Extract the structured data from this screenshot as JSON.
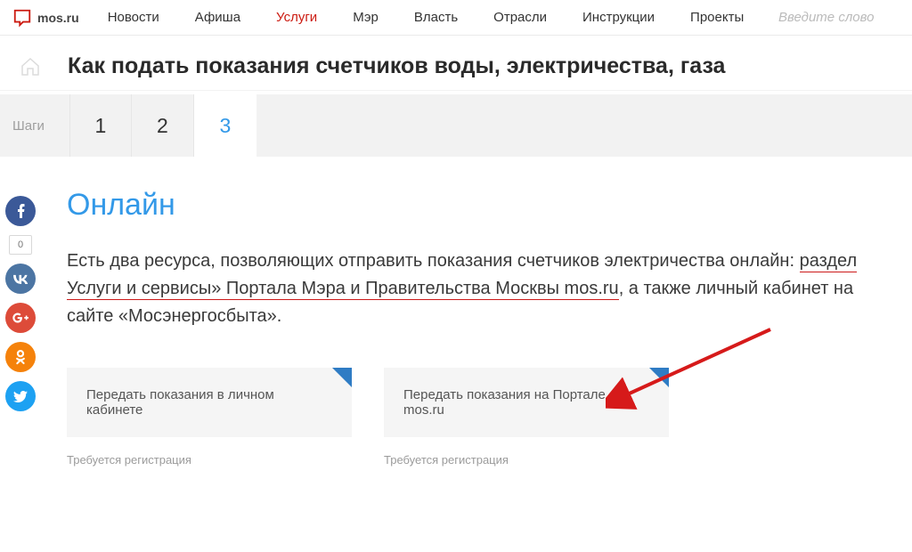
{
  "logo": {
    "text": "mos.ru"
  },
  "nav": {
    "items": [
      "Новости",
      "Афиша",
      "Услуги",
      "Мэр",
      "Власть",
      "Отрасли",
      "Инструкции",
      "Проекты"
    ],
    "active_index": 2
  },
  "search": {
    "placeholder": "Введите слово"
  },
  "page_title": "Как подать показания счетчиков воды, электричества, газа",
  "steps": {
    "label": "Шаги",
    "items": [
      "1",
      "2",
      "3"
    ],
    "active_index": 2
  },
  "section": {
    "heading": "Онлайн",
    "para_pre": "Есть два ресурса, позволяющих отправить показания счетчиков электричества онлайн: ",
    "para_ul": "раздел Услуги и сервисы» Портала Мэра и Правительства Москвы mos.ru",
    "para_post": ", а также личный кабинет на сайте «Мосэнергосбыта»."
  },
  "cards": [
    {
      "title": "Передать показания в личном кабинете",
      "note": "Требуется регистрация"
    },
    {
      "title": "Передать показания на Портале mos.ru",
      "note": "Требуется регистрация"
    }
  ],
  "share": {
    "count": "0"
  }
}
